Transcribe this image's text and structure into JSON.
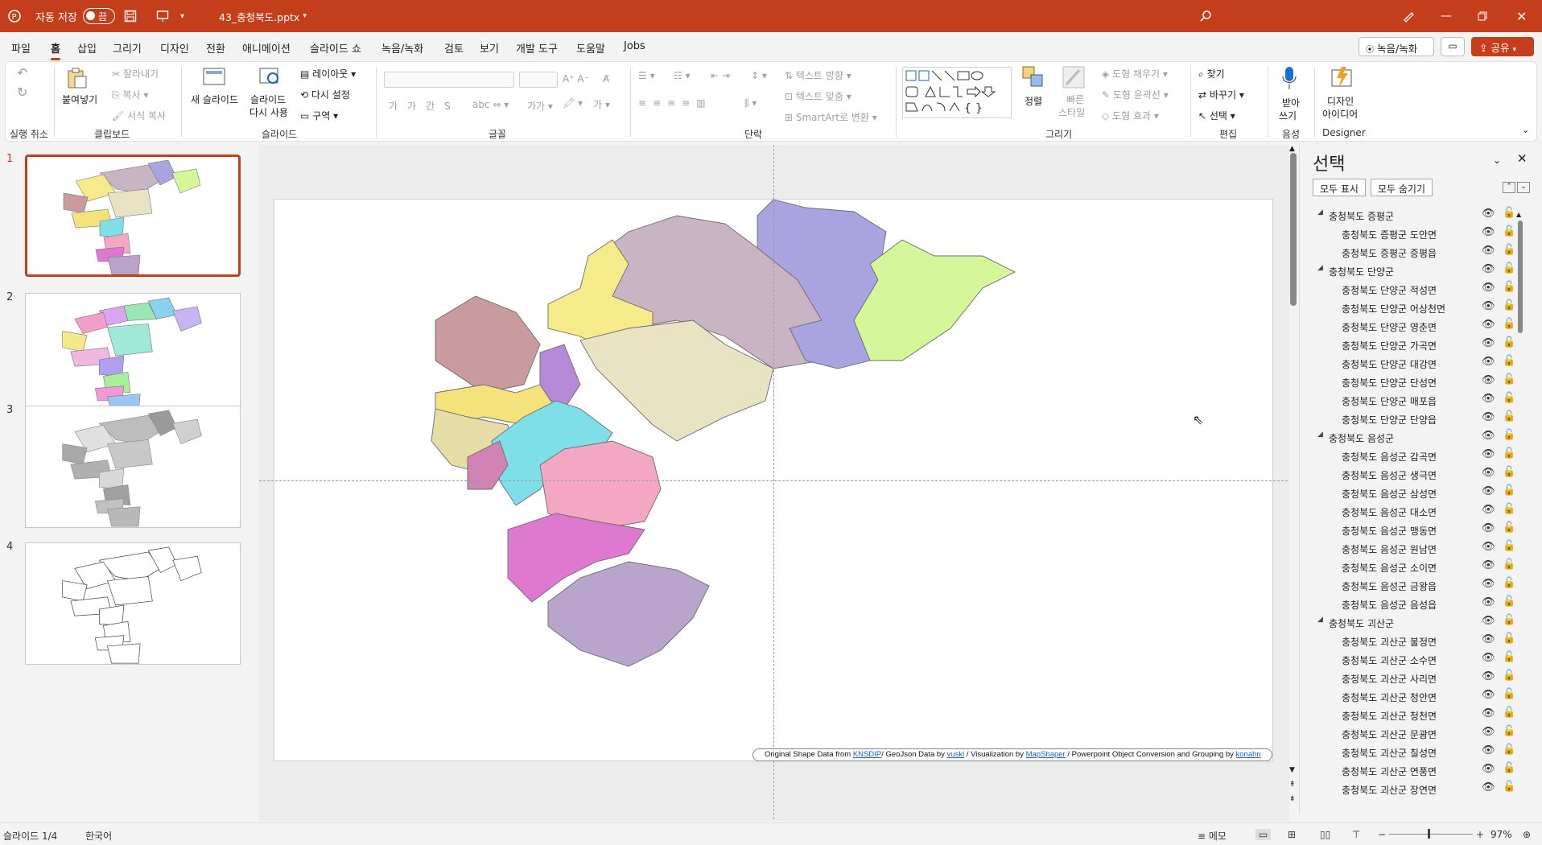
{
  "titlebar": {
    "autosave_label": "자동 저장",
    "autosave_state": "끔",
    "filename": "43_충청북도.pptx",
    "search_icon": "search-icon",
    "bg_color": "#c43e1c"
  },
  "menu": {
    "tabs": [
      "파일",
      "홈",
      "삽입",
      "그리기",
      "디자인",
      "전환",
      "애니메이션",
      "슬라이드 쇼",
      "녹음/녹화",
      "검토",
      "보기",
      "개발 도구",
      "도움말",
      "Jobs"
    ],
    "active": "홈",
    "record_button": "녹음/녹화",
    "share_button": "공유"
  },
  "ribbon": {
    "undo_group": "실행 취소",
    "clipboard": {
      "group": "클립보드",
      "paste": "붙여넣기",
      "cut": "잘라내기",
      "copy": "복사",
      "format_painter": "서식 복사"
    },
    "slides": {
      "group": "슬라이드",
      "new_slide": "새 슬라이드",
      "reuse_line1": "슬라이드",
      "reuse_line2": "다시 사용",
      "layout": "레이아웃",
      "reset": "다시 설정",
      "section": "구역"
    },
    "font": {
      "group": "글꼴"
    },
    "paragraph": {
      "group": "단락",
      "text_direction": "텍스트 방향",
      "align_text": "텍스트 맞춤",
      "smartart": "SmartArt로 변환"
    },
    "drawing": {
      "group": "그리기",
      "arrange": "정렬",
      "quick_styles_line1": "빠른",
      "quick_styles_line2": "스타일",
      "shape_fill": "도형 채우기",
      "shape_outline": "도형 윤곽선",
      "shape_effects": "도형 효과"
    },
    "editing": {
      "group": "편집",
      "find": "찾기",
      "replace": "바꾸기",
      "select": "선택"
    },
    "voice": {
      "group": "음성",
      "dictate_line1": "받아",
      "dictate_line2": "쓰기"
    },
    "designer": {
      "group": "Designer",
      "ideas_line1": "디자인",
      "ideas_line2": "아이디어"
    }
  },
  "thumbnails": {
    "numbers": [
      "1",
      "2",
      "3",
      "4"
    ],
    "selected": 1
  },
  "slide": {
    "credit": {
      "t1": "Original Shape Data from ",
      "l1": "KNSDIP",
      "t2": "/ GeoJson Data by ",
      "l2": "vuski",
      "t3": " / Visualization  by ",
      "l3": "MapShaper",
      "t4": " / Powerpoint Object Conversion and Grouping  by ",
      "l4": "konahn"
    },
    "region_colors": [
      "#c9b4c4",
      "#a9a4e0",
      "#d5f79a",
      "#f5eb8a",
      "#c99b9f",
      "#e8e3c2",
      "#b58ad8",
      "#f4e27a",
      "#e5dca6",
      "#7edfe8",
      "#d283b6",
      "#f3a7c2",
      "#df78cf",
      "#b9a4cc"
    ]
  },
  "selection_pane": {
    "title": "선택",
    "show_all": "모두 표시",
    "hide_all": "모두 숨기기",
    "rows": [
      {
        "level": 0,
        "name": "충청북도 증평군"
      },
      {
        "level": 1,
        "name": "충청북도 증평군 도안면"
      },
      {
        "level": 1,
        "name": "충청북도 증평군 증평읍"
      },
      {
        "level": 0,
        "name": "충청북도 단양군"
      },
      {
        "level": 1,
        "name": "충청북도 단양군 적성면"
      },
      {
        "level": 1,
        "name": "충청북도 단양군 어상천면"
      },
      {
        "level": 1,
        "name": "충청북도 단양군 영춘면"
      },
      {
        "level": 1,
        "name": "충청북도 단양군 가곡면"
      },
      {
        "level": 1,
        "name": "충청북도 단양군 대강면"
      },
      {
        "level": 1,
        "name": "충청북도 단양군 단성면"
      },
      {
        "level": 1,
        "name": "충청북도 단양군 매포읍"
      },
      {
        "level": 1,
        "name": "충청북도 단양군 단양읍"
      },
      {
        "level": 0,
        "name": "충청북도 음성군"
      },
      {
        "level": 1,
        "name": "충청북도 음성군 감곡면"
      },
      {
        "level": 1,
        "name": "충청북도 음성군 생극면"
      },
      {
        "level": 1,
        "name": "충청북도 음성군 삼성면"
      },
      {
        "level": 1,
        "name": "충청북도 음성군 대소면"
      },
      {
        "level": 1,
        "name": "충청북도 음성군 맹동면"
      },
      {
        "level": 1,
        "name": "충청북도 음성군 원남면"
      },
      {
        "level": 1,
        "name": "충청북도 음성군 소이면"
      },
      {
        "level": 1,
        "name": "충청북도 음성군 금왕읍"
      },
      {
        "level": 1,
        "name": "충청북도 음성군 음성읍"
      },
      {
        "level": 0,
        "name": "충청북도 괴산군"
      },
      {
        "level": 1,
        "name": "충청북도 괴산군 불정면"
      },
      {
        "level": 1,
        "name": "충청북도 괴산군 소수면"
      },
      {
        "level": 1,
        "name": "충청북도 괴산군 사리면"
      },
      {
        "level": 1,
        "name": "충청북도 괴산군 청안면"
      },
      {
        "level": 1,
        "name": "충청북도 괴산군 청천면"
      },
      {
        "level": 1,
        "name": "충청북도 괴산군 문광면"
      },
      {
        "level": 1,
        "name": "충청북도 괴산군 칠성면"
      },
      {
        "level": 1,
        "name": "충청북도 괴산군 연풍면"
      },
      {
        "level": 1,
        "name": "충청북도 괴산군 장연면"
      }
    ]
  },
  "status": {
    "slide_info": "슬라이드 1/4",
    "language": "한국어",
    "notes": "메모",
    "zoom": "97%"
  }
}
